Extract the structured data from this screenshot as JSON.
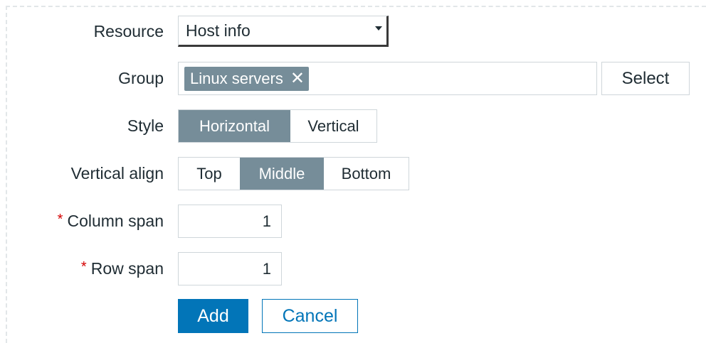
{
  "form": {
    "resource": {
      "label": "Resource",
      "value": "Host info",
      "required": false
    },
    "group": {
      "label": "Group",
      "chips": [
        "Linux servers"
      ],
      "select_button": "Select",
      "required": false
    },
    "style": {
      "label": "Style",
      "options": [
        "Horizontal",
        "Vertical"
      ],
      "selected": "Horizontal",
      "required": false
    },
    "vertical_align": {
      "label": "Vertical align",
      "options": [
        "Top",
        "Middle",
        "Bottom"
      ],
      "selected": "Middle",
      "required": false
    },
    "column_span": {
      "label": "Column span",
      "value": "1",
      "required": true
    },
    "row_span": {
      "label": "Row span",
      "value": "1",
      "required": true
    },
    "required_marker": "*"
  },
  "actions": {
    "add_label": "Add",
    "cancel_label": "Cancel"
  },
  "colors": {
    "active_segment": "#768d99",
    "primary_button": "#0275b8",
    "required_marker": "#d40000",
    "border": "#cfd6da"
  },
  "icons": {
    "remove_chip": "close-icon",
    "dropdown": "chevron-down-icon"
  }
}
